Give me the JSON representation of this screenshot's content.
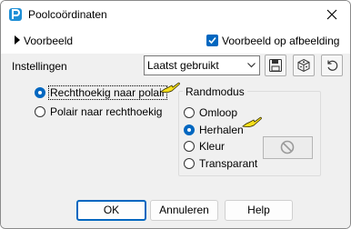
{
  "window": {
    "title": "Poolcoördinaten"
  },
  "preview": {
    "expander_label": "Voorbeeld",
    "checkbox_label": "Voorbeeld op afbeelding",
    "checkbox_checked": true
  },
  "settings": {
    "label": "Instellingen",
    "preset_value": "Laatst gebruikt"
  },
  "conversion": {
    "options": [
      {
        "label": "Rechthoekig naar polair",
        "selected": true
      },
      {
        "label": "Polair naar rechthoekig",
        "selected": false
      }
    ]
  },
  "edge_mode": {
    "title": "Randmodus",
    "options": [
      {
        "label": "Omloop",
        "selected": false
      },
      {
        "label": "Herhalen",
        "selected": true
      },
      {
        "label": "Kleur",
        "selected": false
      },
      {
        "label": "Transparant",
        "selected": false
      }
    ]
  },
  "buttons": {
    "ok": "OK",
    "cancel": "Annuleren",
    "help": "Help"
  },
  "colors": {
    "accent": "#0067c0",
    "panel_bg": "#f0f0f0",
    "pointer_yellow": "#f7e01a"
  }
}
